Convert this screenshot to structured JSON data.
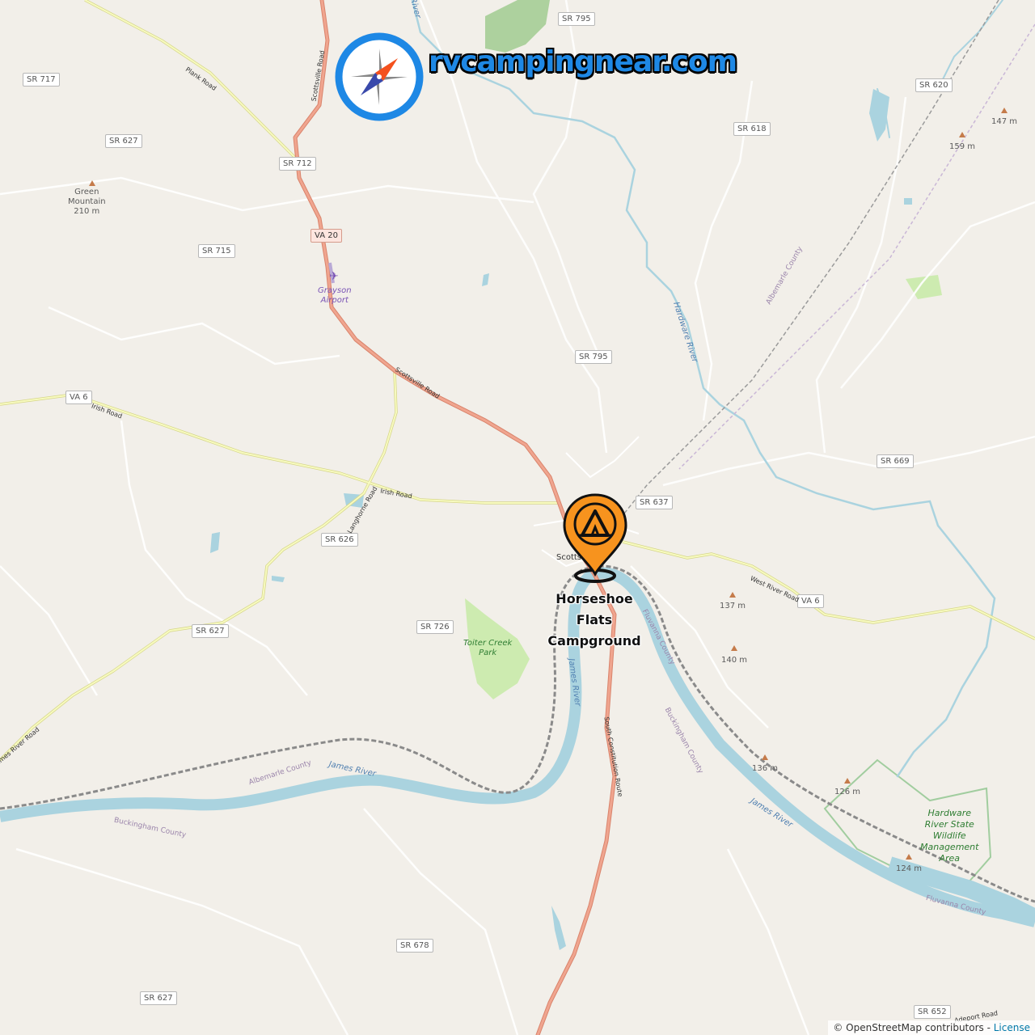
{
  "brand": {
    "site_name": "rvcampingnear.com",
    "logo_icon": "compass-icon"
  },
  "campground": {
    "name_lines": [
      "Horseshoe",
      "Flats",
      "Campground"
    ],
    "marker_icon": "tent-pin-icon",
    "marker_color": "#f7931e"
  },
  "town": {
    "name": "Scotts"
  },
  "road_shields": [
    {
      "id": "sr795a",
      "text": "SR 795"
    },
    {
      "id": "sr717",
      "text": "SR 717"
    },
    {
      "id": "sr620",
      "text": "SR 620"
    },
    {
      "id": "sr627a",
      "text": "SR 627"
    },
    {
      "id": "sr618",
      "text": "SR 618"
    },
    {
      "id": "sr712",
      "text": "SR 712"
    },
    {
      "id": "va20",
      "text": "VA 20"
    },
    {
      "id": "sr715",
      "text": "SR 715"
    },
    {
      "id": "sr795b",
      "text": "SR 795"
    },
    {
      "id": "va6a",
      "text": "VA 6"
    },
    {
      "id": "sr669",
      "text": "SR 669"
    },
    {
      "id": "sr637",
      "text": "SR 637"
    },
    {
      "id": "sr626",
      "text": "SR 626"
    },
    {
      "id": "va6b",
      "text": "VA 6"
    },
    {
      "id": "sr726",
      "text": "SR 726"
    },
    {
      "id": "sr627b",
      "text": "SR 627"
    },
    {
      "id": "sr678",
      "text": "SR 678"
    },
    {
      "id": "sr627c",
      "text": "SR 627"
    },
    {
      "id": "sr652",
      "text": "SR 652"
    }
  ],
  "places": {
    "green_mountain": [
      "Green",
      "Mountain",
      "210 m"
    ],
    "grayson_airport": [
      "Grayson",
      "Airport"
    ],
    "toiter_creek_park": [
      "Toiter Creek",
      "Park"
    ],
    "hardware_wma": [
      "Hardware",
      "River State",
      "Wildlife",
      "Management",
      "Area"
    ]
  },
  "elevations": {
    "e147": "147 m",
    "e159": "159 m",
    "e137": "137 m",
    "e140": "140 m",
    "e136": "136 m",
    "e126": "126 m",
    "e124": "124 m"
  },
  "road_names": {
    "plank": "Plank Road",
    "scottsville_n": "Scottsville Road",
    "scottsville": "Scottsville Road",
    "irish_w": "Irish Road",
    "irish_e": "Irish Road",
    "langhorne": "Langhorne Road",
    "west_river": "West River Road",
    "james_river_rd": "James River Road",
    "south_constitution": "South Constitution Route",
    "adeport": "Adeport Road"
  },
  "water_names": {
    "hardware_river": "Hardware River",
    "james_river_w": "James River",
    "james_river_s": "James River",
    "james_river_e": "James River",
    "river_n": "River"
  },
  "county_names": {
    "albemarle_ne": "Albemarle County",
    "albemarle_sw": "Albemarle County",
    "buckingham_w": "Buckingham County",
    "buckingham_e": "Buckingham County",
    "fluvanna_n": "Fluvanna County",
    "fluvanna_e": "Fluvanna County"
  },
  "attribution": {
    "text": "© OpenStreetMap contributors - ",
    "link": "License"
  },
  "colors": {
    "land": "#f2efe9",
    "water": "#aad3df",
    "primary_road": "#f0a58f",
    "secondary_road": "#f7fabf",
    "park": "#cdebb0",
    "brand": "#1e88e5"
  }
}
